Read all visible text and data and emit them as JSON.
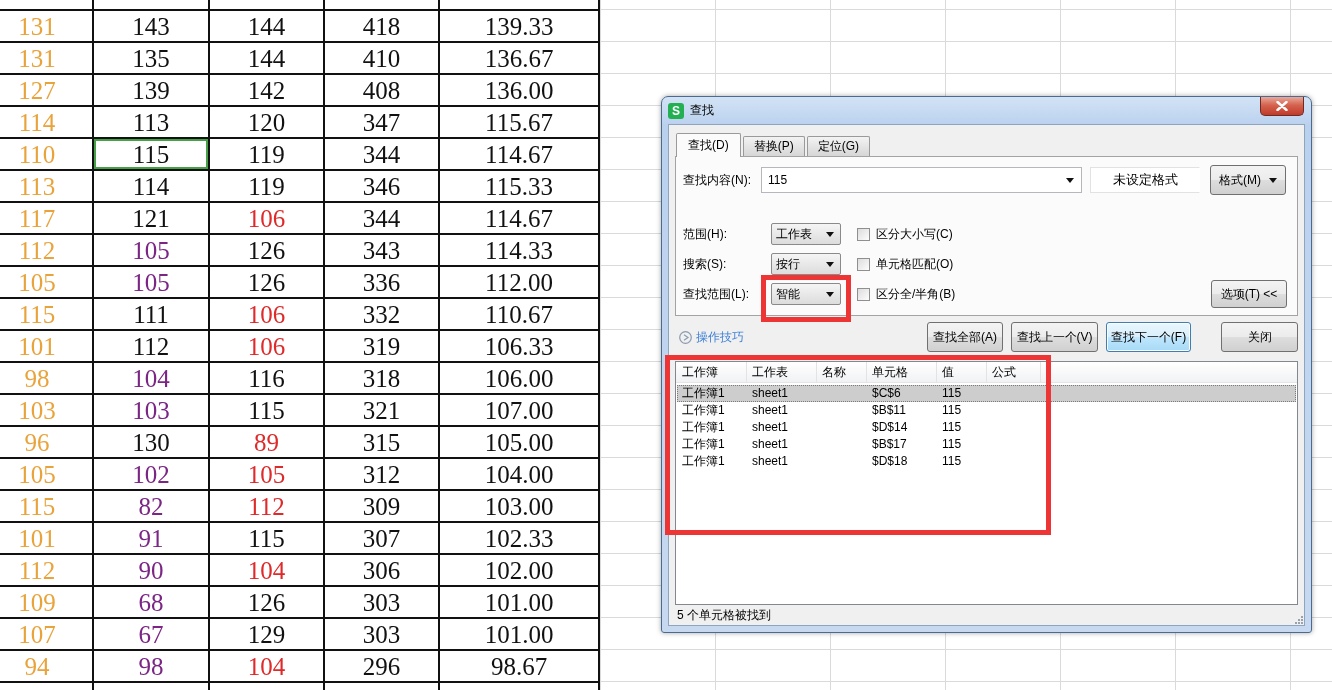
{
  "sheet": {
    "rows": [
      {
        "cells": [
          {
            "text": "131",
            "color": "#e9a33b",
            "selected": false
          },
          {
            "text": "143",
            "color": "#111111",
            "selected": false
          },
          {
            "text": "144",
            "color": "#111111",
            "selected": false
          },
          {
            "text": "418",
            "color": "#111111",
            "selected": false
          },
          {
            "text": "139.33",
            "color": "#111111",
            "selected": false
          }
        ]
      },
      {
        "cells": [
          {
            "text": "131",
            "color": "#e9a33b",
            "selected": false
          },
          {
            "text": "135",
            "color": "#111111",
            "selected": false
          },
          {
            "text": "144",
            "color": "#111111",
            "selected": false
          },
          {
            "text": "410",
            "color": "#111111",
            "selected": false
          },
          {
            "text": "136.67",
            "color": "#111111",
            "selected": false
          }
        ]
      },
      {
        "cells": [
          {
            "text": "127",
            "color": "#e9a33b",
            "selected": false
          },
          {
            "text": "139",
            "color": "#111111",
            "selected": false
          },
          {
            "text": "142",
            "color": "#111111",
            "selected": false
          },
          {
            "text": "408",
            "color": "#111111",
            "selected": false
          },
          {
            "text": "136.00",
            "color": "#111111",
            "selected": false
          }
        ]
      },
      {
        "cells": [
          {
            "text": "114",
            "color": "#e9a33b",
            "selected": false
          },
          {
            "text": "113",
            "color": "#111111",
            "selected": false
          },
          {
            "text": "120",
            "color": "#111111",
            "selected": false
          },
          {
            "text": "347",
            "color": "#111111",
            "selected": false
          },
          {
            "text": "115.67",
            "color": "#111111",
            "selected": false
          }
        ]
      },
      {
        "cells": [
          {
            "text": "110",
            "color": "#e9a33b",
            "selected": false
          },
          {
            "text": "115",
            "color": "#111111",
            "selected": true
          },
          {
            "text": "119",
            "color": "#111111",
            "selected": false
          },
          {
            "text": "344",
            "color": "#111111",
            "selected": false
          },
          {
            "text": "114.67",
            "color": "#111111",
            "selected": false
          }
        ]
      },
      {
        "cells": [
          {
            "text": "113",
            "color": "#e9a33b",
            "selected": false
          },
          {
            "text": "114",
            "color": "#111111",
            "selected": false
          },
          {
            "text": "119",
            "color": "#111111",
            "selected": false
          },
          {
            "text": "346",
            "color": "#111111",
            "selected": false
          },
          {
            "text": "115.33",
            "color": "#111111",
            "selected": false
          }
        ]
      },
      {
        "cells": [
          {
            "text": "117",
            "color": "#e9a33b",
            "selected": false
          },
          {
            "text": "121",
            "color": "#111111",
            "selected": false
          },
          {
            "text": "106",
            "color": "#de2a2a",
            "selected": false
          },
          {
            "text": "344",
            "color": "#111111",
            "selected": false
          },
          {
            "text": "114.67",
            "color": "#111111",
            "selected": false
          }
        ]
      },
      {
        "cells": [
          {
            "text": "112",
            "color": "#e9a33b",
            "selected": false
          },
          {
            "text": "105",
            "color": "#7b2585",
            "selected": false
          },
          {
            "text": "126",
            "color": "#111111",
            "selected": false
          },
          {
            "text": "343",
            "color": "#111111",
            "selected": false
          },
          {
            "text": "114.33",
            "color": "#111111",
            "selected": false
          }
        ]
      },
      {
        "cells": [
          {
            "text": "105",
            "color": "#e9a33b",
            "selected": false
          },
          {
            "text": "105",
            "color": "#7b2585",
            "selected": false
          },
          {
            "text": "126",
            "color": "#111111",
            "selected": false
          },
          {
            "text": "336",
            "color": "#111111",
            "selected": false
          },
          {
            "text": "112.00",
            "color": "#111111",
            "selected": false
          }
        ]
      },
      {
        "cells": [
          {
            "text": "115",
            "color": "#e9a33b",
            "selected": false
          },
          {
            "text": "111",
            "color": "#111111",
            "selected": false
          },
          {
            "text": "106",
            "color": "#de2a2a",
            "selected": false
          },
          {
            "text": "332",
            "color": "#111111",
            "selected": false
          },
          {
            "text": "110.67",
            "color": "#111111",
            "selected": false
          }
        ]
      },
      {
        "cells": [
          {
            "text": "101",
            "color": "#e9a33b",
            "selected": false
          },
          {
            "text": "112",
            "color": "#111111",
            "selected": false
          },
          {
            "text": "106",
            "color": "#de2a2a",
            "selected": false
          },
          {
            "text": "319",
            "color": "#111111",
            "selected": false
          },
          {
            "text": "106.33",
            "color": "#111111",
            "selected": false
          }
        ]
      },
      {
        "cells": [
          {
            "text": "98",
            "color": "#e9a33b",
            "selected": false
          },
          {
            "text": "104",
            "color": "#7b2585",
            "selected": false
          },
          {
            "text": "116",
            "color": "#111111",
            "selected": false
          },
          {
            "text": "318",
            "color": "#111111",
            "selected": false
          },
          {
            "text": "106.00",
            "color": "#111111",
            "selected": false
          }
        ]
      },
      {
        "cells": [
          {
            "text": "103",
            "color": "#e9a33b",
            "selected": false
          },
          {
            "text": "103",
            "color": "#7b2585",
            "selected": false
          },
          {
            "text": "115",
            "color": "#111111",
            "selected": false
          },
          {
            "text": "321",
            "color": "#111111",
            "selected": false
          },
          {
            "text": "107.00",
            "color": "#111111",
            "selected": false
          }
        ]
      },
      {
        "cells": [
          {
            "text": "96",
            "color": "#e9a33b",
            "selected": false
          },
          {
            "text": "130",
            "color": "#111111",
            "selected": false
          },
          {
            "text": "89",
            "color": "#de2a2a",
            "selected": false
          },
          {
            "text": "315",
            "color": "#111111",
            "selected": false
          },
          {
            "text": "105.00",
            "color": "#111111",
            "selected": false
          }
        ]
      },
      {
        "cells": [
          {
            "text": "105",
            "color": "#e9a33b",
            "selected": false
          },
          {
            "text": "102",
            "color": "#7b2585",
            "selected": false
          },
          {
            "text": "105",
            "color": "#de2a2a",
            "selected": false
          },
          {
            "text": "312",
            "color": "#111111",
            "selected": false
          },
          {
            "text": "104.00",
            "color": "#111111",
            "selected": false
          }
        ]
      },
      {
        "cells": [
          {
            "text": "115",
            "color": "#e9a33b",
            "selected": false
          },
          {
            "text": "82",
            "color": "#7b2585",
            "selected": false
          },
          {
            "text": "112",
            "color": "#de2a2a",
            "selected": false
          },
          {
            "text": "309",
            "color": "#111111",
            "selected": false
          },
          {
            "text": "103.00",
            "color": "#111111",
            "selected": false
          }
        ]
      },
      {
        "cells": [
          {
            "text": "101",
            "color": "#e9a33b",
            "selected": false
          },
          {
            "text": "91",
            "color": "#7b2585",
            "selected": false
          },
          {
            "text": "115",
            "color": "#111111",
            "selected": false
          },
          {
            "text": "307",
            "color": "#111111",
            "selected": false
          },
          {
            "text": "102.33",
            "color": "#111111",
            "selected": false
          }
        ]
      },
      {
        "cells": [
          {
            "text": "112",
            "color": "#e9a33b",
            "selected": false
          },
          {
            "text": "90",
            "color": "#7b2585",
            "selected": false
          },
          {
            "text": "104",
            "color": "#de2a2a",
            "selected": false
          },
          {
            "text": "306",
            "color": "#111111",
            "selected": false
          },
          {
            "text": "102.00",
            "color": "#111111",
            "selected": false
          }
        ]
      },
      {
        "cells": [
          {
            "text": "109",
            "color": "#e9a33b",
            "selected": false
          },
          {
            "text": "68",
            "color": "#7b2585",
            "selected": false
          },
          {
            "text": "126",
            "color": "#111111",
            "selected": false
          },
          {
            "text": "303",
            "color": "#111111",
            "selected": false
          },
          {
            "text": "101.00",
            "color": "#111111",
            "selected": false
          }
        ]
      },
      {
        "cells": [
          {
            "text": "107",
            "color": "#e9a33b",
            "selected": false
          },
          {
            "text": "67",
            "color": "#7b2585",
            "selected": false
          },
          {
            "text": "129",
            "color": "#111111",
            "selected": false
          },
          {
            "text": "303",
            "color": "#111111",
            "selected": false
          },
          {
            "text": "101.00",
            "color": "#111111",
            "selected": false
          }
        ]
      },
      {
        "cells": [
          {
            "text": "94",
            "color": "#e9a33b",
            "selected": false
          },
          {
            "text": "98",
            "color": "#7b2585",
            "selected": false
          },
          {
            "text": "104",
            "color": "#de2a2a",
            "selected": false
          },
          {
            "text": "296",
            "color": "#111111",
            "selected": false
          },
          {
            "text": "98.67",
            "color": "#111111",
            "selected": false
          }
        ]
      }
    ]
  },
  "dialog": {
    "title": "查找",
    "icon_letter": "S",
    "tabs": [
      {
        "label": "查找(D)",
        "selected": true
      },
      {
        "label": "替换(P)",
        "selected": false
      },
      {
        "label": "定位(G)",
        "selected": false
      }
    ],
    "find_field": {
      "label": "查找内容(N):",
      "value": "115"
    },
    "format_preview": "未设定格式",
    "format_button": "格式(M)",
    "options": [
      {
        "label": "范围(H):",
        "value": "工作表",
        "highlighted": false,
        "checkbox": {
          "label": "区分大小写(C)",
          "checked": false
        }
      },
      {
        "label": "搜索(S):",
        "value": "按行",
        "highlighted": false,
        "checkbox": {
          "label": "单元格匹配(O)",
          "checked": false
        }
      },
      {
        "label": "查找范围(L):",
        "value": "智能",
        "highlighted": true,
        "checkbox": {
          "label": "区分全/半角(B)",
          "checked": false
        }
      }
    ],
    "options_button": "选项(T) <<",
    "help_link": "操作技巧",
    "buttons": [
      {
        "label": "查找全部(A)",
        "focused": false
      },
      {
        "label": "查找上一个(V)",
        "focused": false
      },
      {
        "label": "查找下一个(F)",
        "focused": true
      },
      {
        "label": "关闭",
        "focused": false
      }
    ],
    "results": {
      "highlighted": true,
      "columns": [
        "工作簿",
        "工作表",
        "名称",
        "单元格",
        "值",
        "公式"
      ],
      "rows": [
        {
          "workbook": "工作簿1",
          "sheet": "sheet1",
          "cell": "$C$6",
          "value": "115",
          "selected": true
        },
        {
          "workbook": "工作簿1",
          "sheet": "sheet1",
          "cell": "$B$11",
          "value": "115",
          "selected": false
        },
        {
          "workbook": "工作簿1",
          "sheet": "sheet1",
          "cell": "$D$14",
          "value": "115",
          "selected": false
        },
        {
          "workbook": "工作簿1",
          "sheet": "sheet1",
          "cell": "$B$17",
          "value": "115",
          "selected": false
        },
        {
          "workbook": "工作簿1",
          "sheet": "sheet1",
          "cell": "$D$18",
          "value": "115",
          "selected": false
        }
      ]
    },
    "status": "5 个单元格被找到"
  }
}
